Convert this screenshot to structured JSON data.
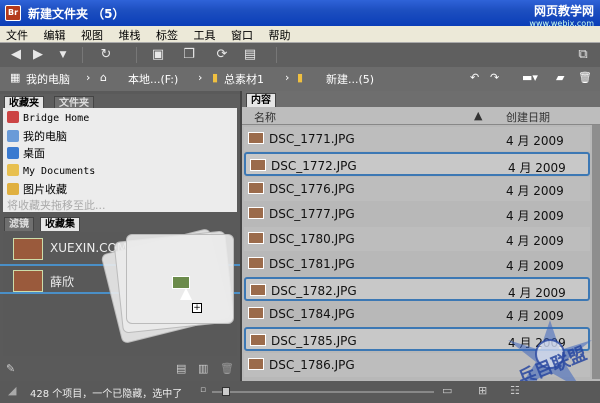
{
  "window": {
    "title": "新建文件夹 （5）",
    "app_badge": "Br"
  },
  "watermark": {
    "line1": "网页教学网",
    "line2": "www.webjx.com",
    "logo": "兵目联盟"
  },
  "menu": [
    "文件",
    "编辑",
    "视图",
    "堆栈",
    "标签",
    "工具",
    "窗口",
    "帮助"
  ],
  "search": {
    "value": "",
    "placeholder": ""
  },
  "path": [
    "我的电脑",
    "本地...(F:)",
    "总素材1",
    "新建...(5)"
  ],
  "left": {
    "top_tabs": [
      "收藏夹",
      "文件夹"
    ],
    "favorites": [
      "Bridge Home",
      "我的电脑",
      "桌面",
      "My Documents",
      "图片收藏",
      "将收藏夹拖移至此..."
    ],
    "bottom_tabs": [
      "滤镜",
      "收藏集"
    ],
    "collections": [
      "XUEXIN.COM",
      "薛欣"
    ]
  },
  "right": {
    "tab": "内容",
    "columns": {
      "name": "名称",
      "date": "创建日期"
    },
    "rows": [
      {
        "name": "DSC_1771.JPG",
        "date": "4 月 2009"
      },
      {
        "name": "DSC_1772.JPG",
        "date": "4 月 2009"
      },
      {
        "name": "DSC_1776.JPG",
        "date": "4 月 2009"
      },
      {
        "name": "DSC_1777.JPG",
        "date": "4 月 2009"
      },
      {
        "name": "DSC_1780.JPG",
        "date": "4 月 2009"
      },
      {
        "name": "DSC_1781.JPG",
        "date": "4 月 2009"
      },
      {
        "name": "DSC_1782.JPG",
        "date": "4 月 2009"
      },
      {
        "name": "DSC_1784.JPG",
        "date": "4 月 2009"
      },
      {
        "name": "DSC_1785.JPG",
        "date": "4 月 2009"
      },
      {
        "name": "DSC_1786.JPG",
        "date": ""
      }
    ]
  },
  "status": {
    "text": "428 个项目，一个已隐藏，选中了"
  },
  "colors": {
    "accent": "#3c78b4",
    "title": "#1d4fc0"
  }
}
